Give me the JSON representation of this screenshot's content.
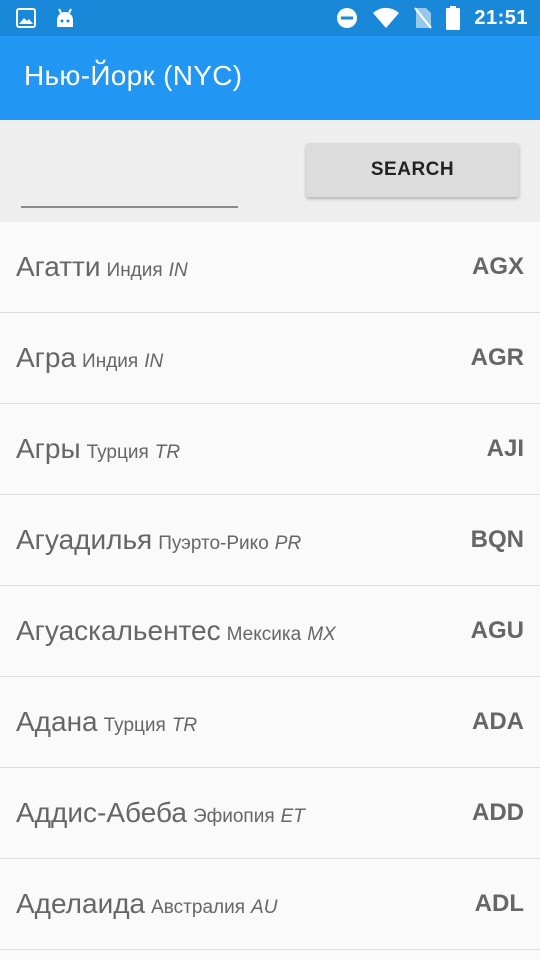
{
  "status_bar": {
    "time": "21:51",
    "icons": [
      "image-icon",
      "android-icon",
      "do-not-disturb-icon",
      "wifi-icon",
      "no-sim-icon",
      "battery-icon"
    ]
  },
  "app_bar": {
    "title": "Нью-Йорк  (NYC)"
  },
  "search": {
    "value": "",
    "placeholder": "",
    "button_label": "SEARCH"
  },
  "airports": [
    {
      "city": "Агатти",
      "country": "Индия",
      "cc": "IN",
      "code": "AGX"
    },
    {
      "city": "Агра",
      "country": "Индия",
      "cc": "IN",
      "code": "AGR"
    },
    {
      "city": "Агры",
      "country": "Турция",
      "cc": "TR",
      "code": "AJI"
    },
    {
      "city": "Агуадилья",
      "country": "Пуэрто-Рико",
      "cc": "PR",
      "code": "BQN"
    },
    {
      "city": "Агуаскальентес",
      "country": "Мексика",
      "cc": "MX",
      "code": "AGU"
    },
    {
      "city": "Адана",
      "country": "Турция",
      "cc": "TR",
      "code": "ADA"
    },
    {
      "city": "Аддис-Абеба",
      "country": "Эфиопия",
      "cc": "ET",
      "code": "ADD"
    },
    {
      "city": "Аделаида",
      "country": "Австралия",
      "cc": "AU",
      "code": "ADL"
    }
  ],
  "colors": {
    "status_bar": "#1a88d8",
    "app_bar": "#2196f3",
    "search_bg": "#eeeeee",
    "text": "#666666"
  }
}
